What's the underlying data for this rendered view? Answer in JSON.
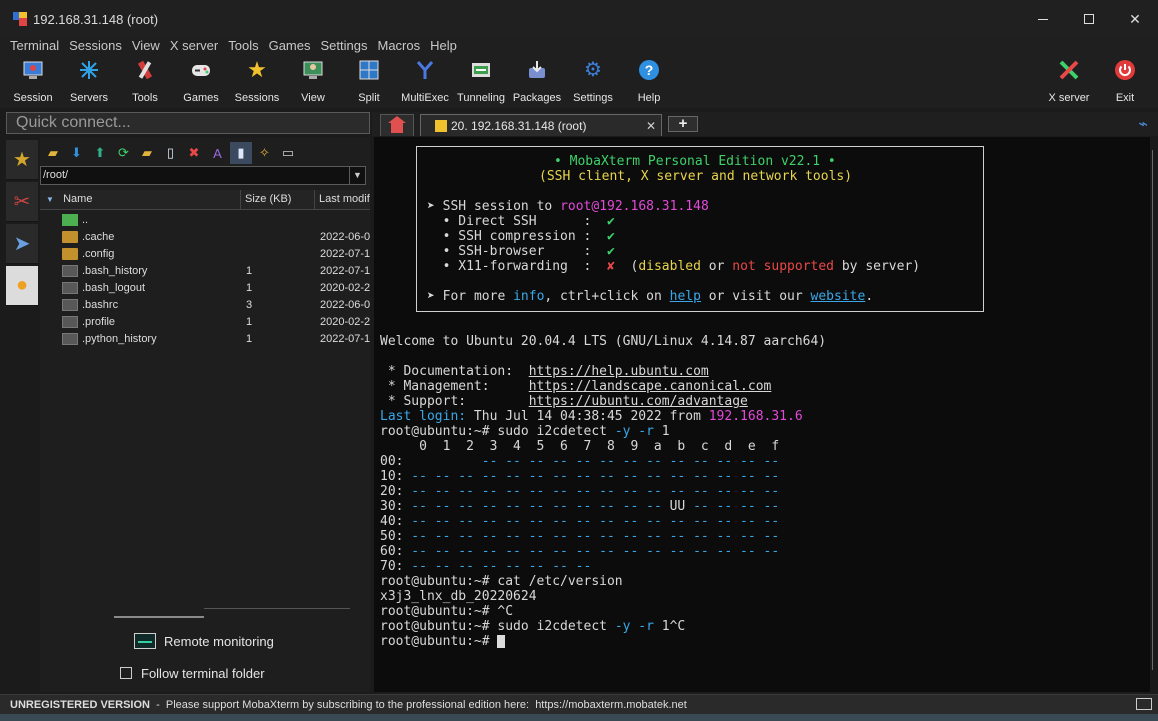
{
  "window": {
    "title": "192.168.31.148 (root)"
  },
  "menu": [
    "Terminal",
    "Sessions",
    "View",
    "X server",
    "Tools",
    "Games",
    "Settings",
    "Macros",
    "Help"
  ],
  "toolbar": {
    "session": "Session",
    "servers": "Servers",
    "tools": "Tools",
    "games": "Games",
    "sessions": "Sessions",
    "view": "View",
    "split": "Split",
    "multiexec": "MultiExec",
    "tunneling": "Tunneling",
    "packages": "Packages",
    "settings": "Settings",
    "help": "Help",
    "xserver": "X server",
    "exit": "Exit"
  },
  "quick_connect": {
    "placeholder": "Quick connect..."
  },
  "file_panel": {
    "path": "/root/",
    "columns": {
      "name": "Name",
      "size": "Size (KB)",
      "modified": "Last modif"
    },
    "rows": [
      {
        "name": "..",
        "size": "",
        "date": "",
        "type": "up"
      },
      {
        "name": ".cache",
        "size": "",
        "date": "2022-06-0",
        "type": "folder"
      },
      {
        "name": ".config",
        "size": "",
        "date": "2022-07-1",
        "type": "folder"
      },
      {
        "name": ".bash_history",
        "size": "1",
        "date": "2022-07-1",
        "type": "file"
      },
      {
        "name": ".bash_logout",
        "size": "1",
        "date": "2020-02-2",
        "type": "file"
      },
      {
        "name": ".bashrc",
        "size": "3",
        "date": "2022-06-0",
        "type": "file"
      },
      {
        "name": ".profile",
        "size": "1",
        "date": "2020-02-2",
        "type": "file"
      },
      {
        "name": ".python_history",
        "size": "1",
        "date": "2022-07-1",
        "type": "file"
      }
    ],
    "remote_monitoring": "Remote monitoring",
    "follow_folder": "Follow terminal folder"
  },
  "tabs": {
    "session_tab": "20. 192.168.31.148 (root)",
    "new_tab": "+"
  },
  "terminal": {
    "banner": {
      "line1": "• MobaXterm Personal Edition v22.1 •",
      "line2": "(SSH client, X server and network tools)",
      "ssh_session_prefix": "➤ SSH session to ",
      "ssh_host": "root@192.168.31.148",
      "direct_ssh": "  • Direct SSH      :  ",
      "ssh_compression": "  • SSH compression :  ",
      "ssh_browser": "  • SSH-browser     :  ",
      "x11": "  • X11-forwarding  :  ",
      "check": "✔",
      "cross": "✘",
      "x11_open": "  (",
      "x11_disabled": "disabled",
      "x11_or": " or ",
      "x11_notsup": "not supported",
      "x11_by": " by server)",
      "more_prefix": "➤ For more ",
      "info": "info",
      "ctrl": ", ctrl+click on ",
      "help": "help",
      "visit": " or visit our ",
      "website": "website",
      "period": "."
    },
    "welcome": "Welcome to Ubuntu 20.04.4 LTS (GNU/Linux 4.14.87 aarch64)",
    "doc_label": " * Documentation:  ",
    "doc_url": "https://help.ubuntu.com",
    "mgmt_label": " * Management:     ",
    "mgmt_url": "https://landscape.canonical.com",
    "support_label": " * Support:        ",
    "support_url": "https://ubuntu.com/advantage",
    "last_login_label": "Last login:",
    "last_login_time": " Thu Jul 14 04:38:45 2022 from ",
    "last_login_ip": "192.168.31.6",
    "prompt": "root@ubuntu:~# ",
    "cmd1_a": "sudo i2cdetect ",
    "cmd1_b": "-y -r",
    "cmd1_c": " 1",
    "i2c_header": "     0  1  2  3  4  5  6  7  8  9  a  b  c  d  e  f",
    "i2c_rows": [
      {
        "label": "00:",
        "cells": "          -- -- -- -- -- -- -- -- -- -- -- -- --"
      },
      {
        "label": "10:",
        "cells": " -- -- -- -- -- -- -- -- -- -- -- -- -- -- -- --"
      },
      {
        "label": "20:",
        "cells": " -- -- -- -- -- -- -- -- -- -- -- -- -- -- -- --"
      },
      {
        "label": "30:",
        "cells_a": " -- -- -- -- -- -- -- -- -- -- -- ",
        "uu": "UU",
        "cells_b": " -- -- -- --"
      },
      {
        "label": "40:",
        "cells": " -- -- -- -- -- -- -- -- -- -- -- -- -- -- -- --"
      },
      {
        "label": "50:",
        "cells": " -- -- -- -- -- -- -- -- -- -- -- -- -- -- -- --"
      },
      {
        "label": "60:",
        "cells": " -- -- -- -- -- -- -- -- -- -- -- -- -- -- -- --"
      },
      {
        "label": "70:",
        "cells": " -- -- -- -- -- -- -- --"
      }
    ],
    "cmd2": "cat /etc/version",
    "version_out": "x3j3_lnx_db_20220624",
    "cmd3": "^C",
    "cmd4_a": "sudo i2cdetect ",
    "cmd4_b": "-y -r",
    "cmd4_c": " 1^C"
  },
  "status": {
    "unregistered": "UNREGISTERED VERSION",
    "message": "  -  Please support MobaXterm by subscribing to the professional edition here:  ",
    "url": "https://mobaxterm.mobatek.net"
  },
  "colors": {
    "accent": "#3aa8e8",
    "green": "#3ed16a",
    "magenta": "#e24ad8",
    "red": "#e84848",
    "yellow": "#e8d44d"
  }
}
